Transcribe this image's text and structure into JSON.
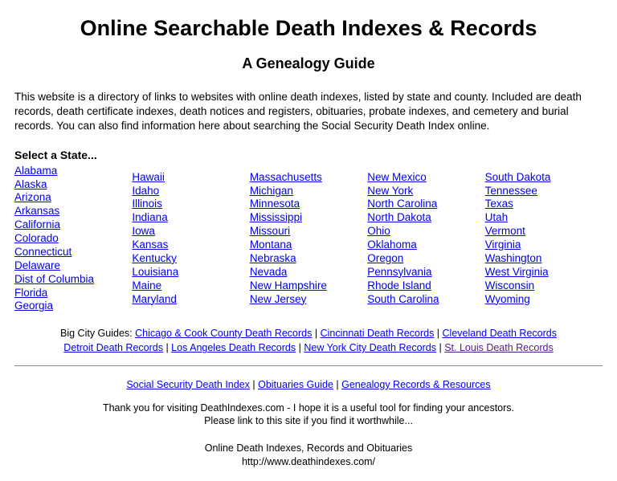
{
  "title": "Online Searchable Death Indexes & Records",
  "subtitle": "A Genealogy Guide",
  "intro": "This website is a directory of links to websites with online death indexes, listed by state and county. Included are death records, death certificate indexes, death notices and registers, obituaries, probate indexes, and cemetery and burial records. You can also find information here about searching the Social Security Death Index online.",
  "select_label": "Select a State...",
  "columns": [
    [
      "Alabama",
      "Alaska",
      "Arizona",
      "Arkansas",
      "California",
      "Colorado",
      "Connecticut",
      "Delaware",
      "Dist of Columbia",
      "Florida",
      "Georgia"
    ],
    [
      "Hawaii",
      "Idaho",
      "Illinois",
      "Indiana",
      "Iowa",
      "Kansas",
      "Kentucky",
      "Louisiana",
      "Maine",
      "Maryland"
    ],
    [
      "Massachusetts",
      "Michigan",
      "Minnesota",
      "Mississippi",
      "Missouri",
      "Montana",
      "Nebraska",
      "Nevada",
      "New Hampshire",
      "New Jersey"
    ],
    [
      "New Mexico",
      "New York",
      "North Carolina",
      "North Dakota",
      "Ohio",
      "Oklahoma",
      "Oregon",
      "Pennsylvania",
      "Rhode Island",
      "South Carolina"
    ],
    [
      "South Dakota",
      "Tennessee",
      "Texas",
      "Utah",
      "Vermont",
      "Virginia",
      "Washington",
      "West Virginia",
      "Wisconsin",
      "Wyoming"
    ]
  ],
  "bigcity": {
    "label": "Big City Guides: ",
    "links1": [
      "Chicago & Cook County Death Records",
      "Cincinnati Death Records",
      "Cleveland Death Records"
    ],
    "links2": [
      "Detroit Death Records",
      "Los Angeles Death Records",
      "New York City Death Records",
      "St. Louis Death Records"
    ],
    "visited_index": 3
  },
  "footer": {
    "links": [
      "Social Security Death Index",
      "Obituaries Guide",
      "Genealogy Records & Resources"
    ],
    "thanks": "Thank you for visiting DeathIndexes.com - I hope it is a useful tool for finding your ancestors.",
    "please": "Please link to this site if you find it worthwhile...",
    "name": "Online Death Indexes, Records and Obituaries",
    "url": "http://www.deathindexes.com/"
  }
}
